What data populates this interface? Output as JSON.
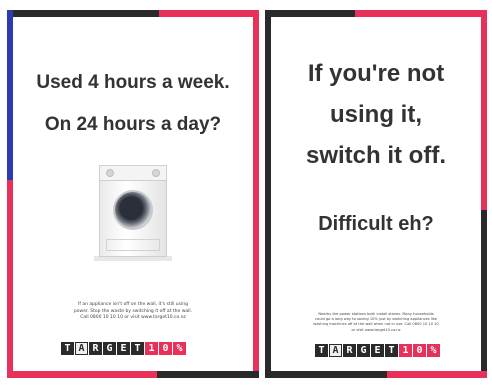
{
  "left_poster": {
    "headline_line1": "Used 4 hours a week.",
    "headline_line2": "On 24 hours a day?",
    "body_line1": "If an appliance isn't off on the wall, it's still using",
    "body_line2": "power. Stop the waste by switching it off at the wall.",
    "body_line3": "Call 0800 10 10 10 or visit www.target10.co.nz",
    "logo_letters": [
      "T",
      "A",
      "R",
      "G",
      "E",
      "T",
      "1",
      "0",
      "%"
    ]
  },
  "right_poster": {
    "headline_line1": "If you're not",
    "headline_line2": "using it,",
    "headline_line3": "switch it off.",
    "tagline": "Difficult eh?",
    "body_line1": "Nearby the power stations both install stoves. Many households",
    "body_line2": "could go a long way to saving 10% just by switching appliances like",
    "body_line3": "washing machines off at the wall when not in use. Call 0800 10 10 10",
    "body_line4": "or visit www.target10.co.nz",
    "logo_letters": [
      "T",
      "A",
      "R",
      "G",
      "E",
      "T",
      "1",
      "0",
      "%"
    ]
  },
  "colors": {
    "dark": "#2a2a2a",
    "pink": "#e8315a",
    "text": "#333333"
  },
  "icons": [
    "washing-machine-image"
  ]
}
